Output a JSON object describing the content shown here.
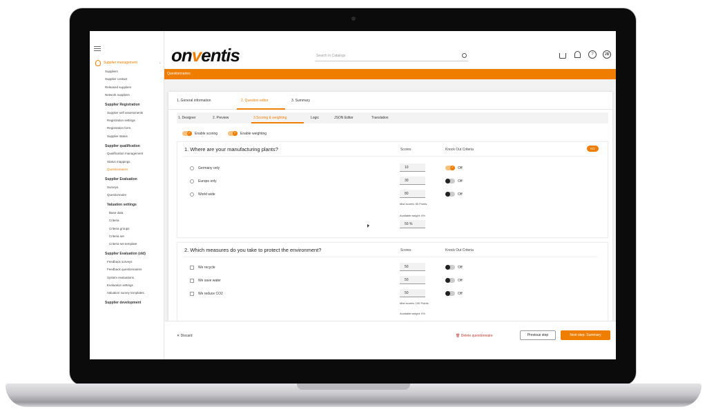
{
  "sidebar": {
    "active_menu": "Supplier management",
    "sections": [
      {
        "title": null,
        "items": [
          "Suppliers",
          "Supplier contact",
          "Released suppliers",
          "Network suppliers"
        ]
      },
      {
        "title": "Supplier Registration",
        "items": [
          "Supplier self assessments",
          "Registration settings",
          "Registration form",
          "Supplier status"
        ]
      },
      {
        "title": "Supplier qualification",
        "items": [
          "Qualification management",
          "Status mappings",
          "Questionnaires"
        ]
      },
      {
        "title": "Supplier Evaluation",
        "items": [
          "Surveys",
          "Questionnaire"
        ]
      },
      {
        "title": "Valuation settings",
        "items": [
          "Base data",
          "Criteria",
          "Criteria groups",
          "Criteria set",
          "Criteria set template"
        ]
      },
      {
        "title": "Supplier Evaluation (old)",
        "items": [
          "Feedback surveys",
          "Feedback questionnaires",
          "System evaluations",
          "Evaluation settings",
          "Valuation survey templates"
        ]
      },
      {
        "title": "Supplier development",
        "items": []
      }
    ]
  },
  "header": {
    "logo_pre": "on",
    "logo_accent": "v",
    "logo_post": "entis",
    "search_placeholder": "Search in Catalogs",
    "avatar_initials": "JB",
    "help_icon": "?"
  },
  "breadcrumb": "Questionnaires",
  "steps": [
    "1. General information",
    "2. Question editor",
    "3. Summary"
  ],
  "subtabs": [
    "1. Designer",
    "2. Preview",
    "3.Scoring & weighting",
    "Logic",
    "JSON Editor",
    "Translation"
  ],
  "toggles": {
    "enable_scoring": "Enable scoring",
    "enable_weighting": "Enable weighting"
  },
  "question1": {
    "title": "1. Where are your manufacturing plants?",
    "scores_header": "Scores",
    "ko_header": "Knock Out Criteria",
    "ko_badge": "KO",
    "options": [
      {
        "label": "Germany only",
        "score": "10",
        "ko": "Off",
        "ko_on": true
      },
      {
        "label": "Europe only",
        "score": "30",
        "ko": "Off",
        "ko_on": false
      },
      {
        "label": "World wide",
        "score": "80",
        "ko": "Off",
        "ko_on": false
      }
    ],
    "max_score": "Max scores: 80 Points",
    "available_weight_label": "Available weight: 0%",
    "weight_value": "50 %"
  },
  "question2": {
    "title": "2. Which measures do you take to protect the environment?",
    "scores_header": "Scores",
    "ko_header": "Knock Out Criteria",
    "options": [
      {
        "label": "We recycle",
        "score": "50",
        "ko": "Off"
      },
      {
        "label": "We save water",
        "score": "50",
        "ko": "Off"
      },
      {
        "label": "We reduce CO2",
        "score": "50",
        "ko": "Off"
      }
    ],
    "max_score": "Max scores: 150 Points",
    "available_weight_label": "Available weight: 0%"
  },
  "footer": {
    "discard": "Discard",
    "delete": "Delete questionnaire",
    "previous": "Previous step",
    "next": "Next step: Summary"
  },
  "colors": {
    "accent": "#ef7d00"
  }
}
